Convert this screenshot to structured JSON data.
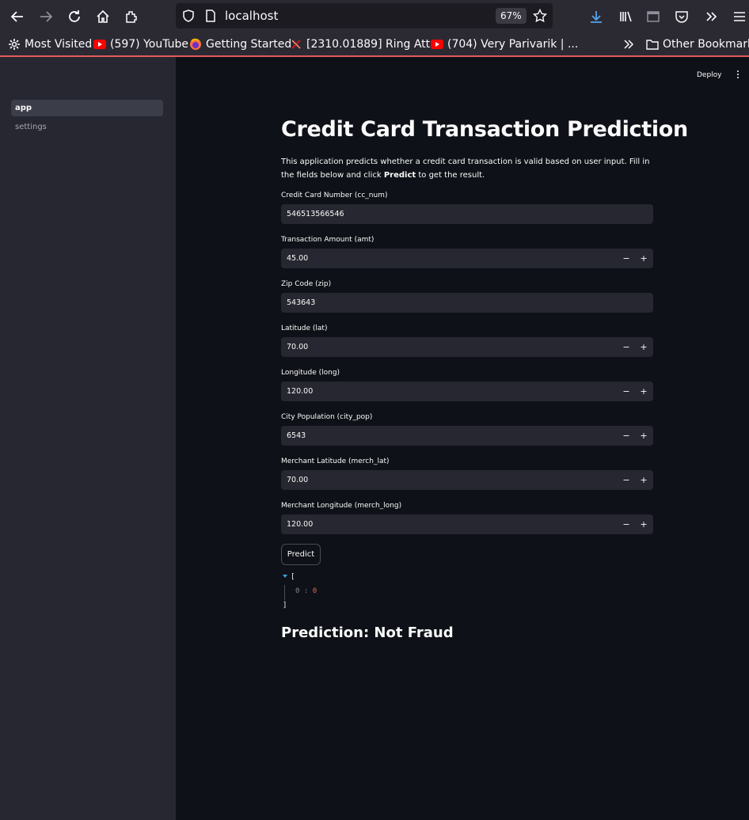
{
  "browser": {
    "url": "localhost",
    "zoom": "67%",
    "bookmarks": [
      {
        "label": "Most Visited",
        "icon": "gear-icon"
      },
      {
        "label": "(597) YouTube",
        "icon": "youtube-icon"
      },
      {
        "label": "Getting Started",
        "icon": "firefox-icon"
      },
      {
        "label": "[2310.01889] Ring Att...",
        "icon": "arxiv-icon"
      },
      {
        "label": "(704) Very Parivarik | ...",
        "icon": "youtube-icon"
      }
    ],
    "other_bookmarks": "Other Bookmarks"
  },
  "sidebar": {
    "items": [
      {
        "label": "app",
        "active": true
      },
      {
        "label": "settings",
        "active": false
      }
    ]
  },
  "header": {
    "deploy_label": "Deploy"
  },
  "main": {
    "title": "Credit Card Transaction Prediction",
    "description_pre": "This application predicts whether a credit card transaction is valid based on user input. Fill in the fields below and click ",
    "description_bold": "Predict",
    "description_post": " to get the result.",
    "fields": [
      {
        "label": "Credit Card Number (cc_num)",
        "value": "546513566546",
        "stepper": false
      },
      {
        "label": "Transaction Amount (amt)",
        "value": "45.00",
        "stepper": true
      },
      {
        "label": "Zip Code (zip)",
        "value": "543643",
        "stepper": false
      },
      {
        "label": "Latitude (lat)",
        "value": "70.00",
        "stepper": true
      },
      {
        "label": "Longitude (long)",
        "value": "120.00",
        "stepper": true
      },
      {
        "label": "City Population (city_pop)",
        "value": "6543",
        "stepper": true
      },
      {
        "label": "Merchant Latitude (merch_lat)",
        "value": "70.00",
        "stepper": true
      },
      {
        "label": "Merchant Longitude (merch_long)",
        "value": "120.00",
        "stepper": true
      }
    ],
    "stepper_minus": "−",
    "stepper_plus": "+",
    "predict_label": "Predict",
    "json_output": {
      "open": "[",
      "key": "0",
      "sep": ":",
      "value": "0",
      "close": "]"
    },
    "result": "Prediction: Not Fraud"
  }
}
